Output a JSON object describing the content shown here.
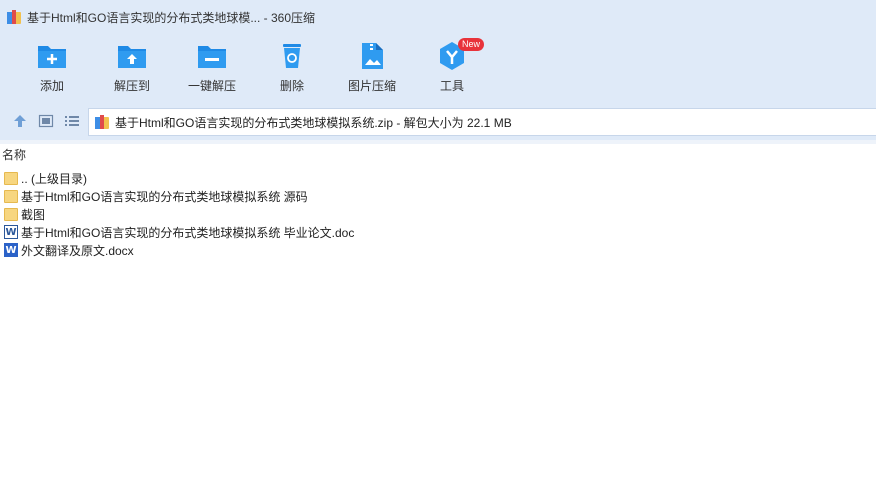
{
  "window": {
    "title": "基于Html和GO语言实现的分布式类地球模... - 360压缩"
  },
  "toolbar": {
    "items": [
      {
        "label": "添加",
        "icon": "add-icon"
      },
      {
        "label": "解压到",
        "icon": "extract-to-icon"
      },
      {
        "label": "一键解压",
        "icon": "one-click-extract-icon"
      },
      {
        "label": "删除",
        "icon": "delete-icon"
      },
      {
        "label": "图片压缩",
        "icon": "image-compress-icon"
      },
      {
        "label": "工具",
        "icon": "tools-icon",
        "badge": "New"
      }
    ]
  },
  "address": {
    "path": "基于Html和GO语言实现的分布式类地球模拟系统.zip - 解包大小为 22.1 MB"
  },
  "list": {
    "header": "名称",
    "files": [
      {
        "name": ".. (上级目录)",
        "type": "folder"
      },
      {
        "name": "基于Html和GO语言实现的分布式类地球模拟系统 源码",
        "type": "folder"
      },
      {
        "name": "截图",
        "type": "folder"
      },
      {
        "name": "基于Html和GO语言实现的分布式类地球模拟系统 毕业论文.doc",
        "type": "doc"
      },
      {
        "name": "外文翻译及原文.docx",
        "type": "docx"
      }
    ]
  },
  "colors": {
    "toolbar_bg": "#dfeaf8",
    "icon_blue": "#1f8ae6",
    "badge_red": "#e8333b",
    "folder": "#f7d680"
  }
}
